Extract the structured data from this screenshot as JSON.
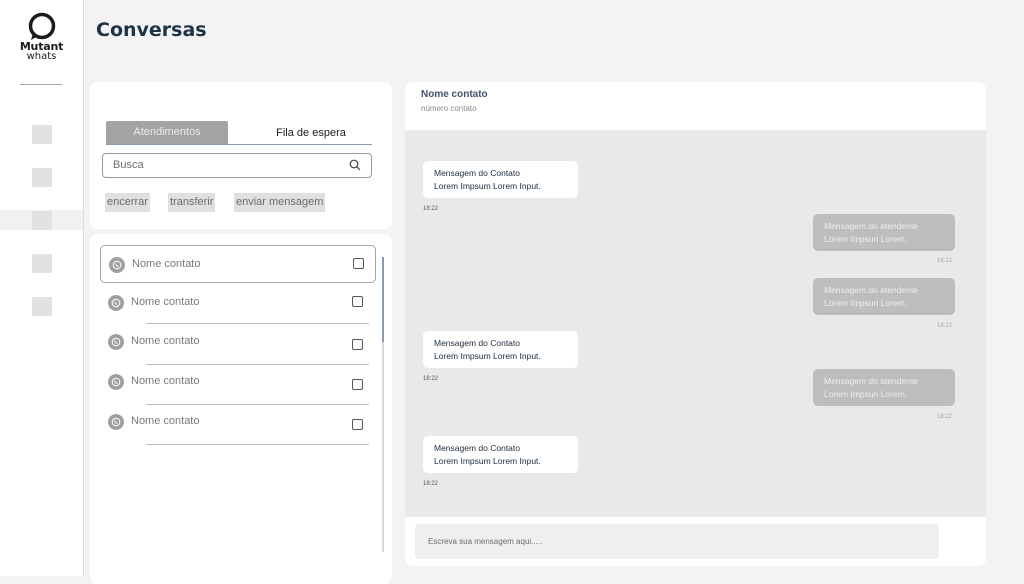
{
  "brand": {
    "name": "Mutant",
    "sub": "whats"
  },
  "page": {
    "title": "Conversas"
  },
  "tabs": {
    "active": "Atendimentos",
    "inactive": "Fila de espera"
  },
  "search": {
    "placeholder": "Busca"
  },
  "actions": [
    "encerrar",
    "transferir",
    "enviar mensagem"
  ],
  "contacts": [
    {
      "name": "Nome contato"
    },
    {
      "name": "Nome contato"
    },
    {
      "name": "Nome contato"
    },
    {
      "name": "Nome contato"
    },
    {
      "name": "Nome contato"
    }
  ],
  "chat": {
    "contact_name": "Nome contato",
    "contact_number": "número contato",
    "messages": [
      {
        "from": "contact",
        "line1": "Mensagem do Contato",
        "line2": "Lorem Impsum Lorem Input.",
        "time": "18:22"
      },
      {
        "from": "agent",
        "line1": "Mensagem do atendente",
        "line2": "Lorem Impsun Lorem.",
        "time": "18:22"
      },
      {
        "from": "agent",
        "line1": "Mensagem do atendente",
        "line2": "Lorem Impsun Lorem.",
        "time": "18:22"
      },
      {
        "from": "contact",
        "line1": "Mensagem do Contato",
        "line2": "Lorem Impsum Lorem Input.",
        "time": "18:22"
      },
      {
        "from": "agent",
        "line1": "Mensagem do atendente",
        "line2": "Lorem Impsun Lorem.",
        "time": "18:22"
      },
      {
        "from": "contact",
        "line1": "Mensagem do Contato",
        "line2": "Lorem Impsum Lorem Input.",
        "time": "18:22"
      }
    ],
    "composer_placeholder": "Escreva sua mensagem aqui....."
  },
  "icons": {
    "logo": "chat-bubble-icon",
    "search": "search-icon",
    "contact": "whatsapp-icon",
    "nav": "nav-placeholder-icon"
  }
}
